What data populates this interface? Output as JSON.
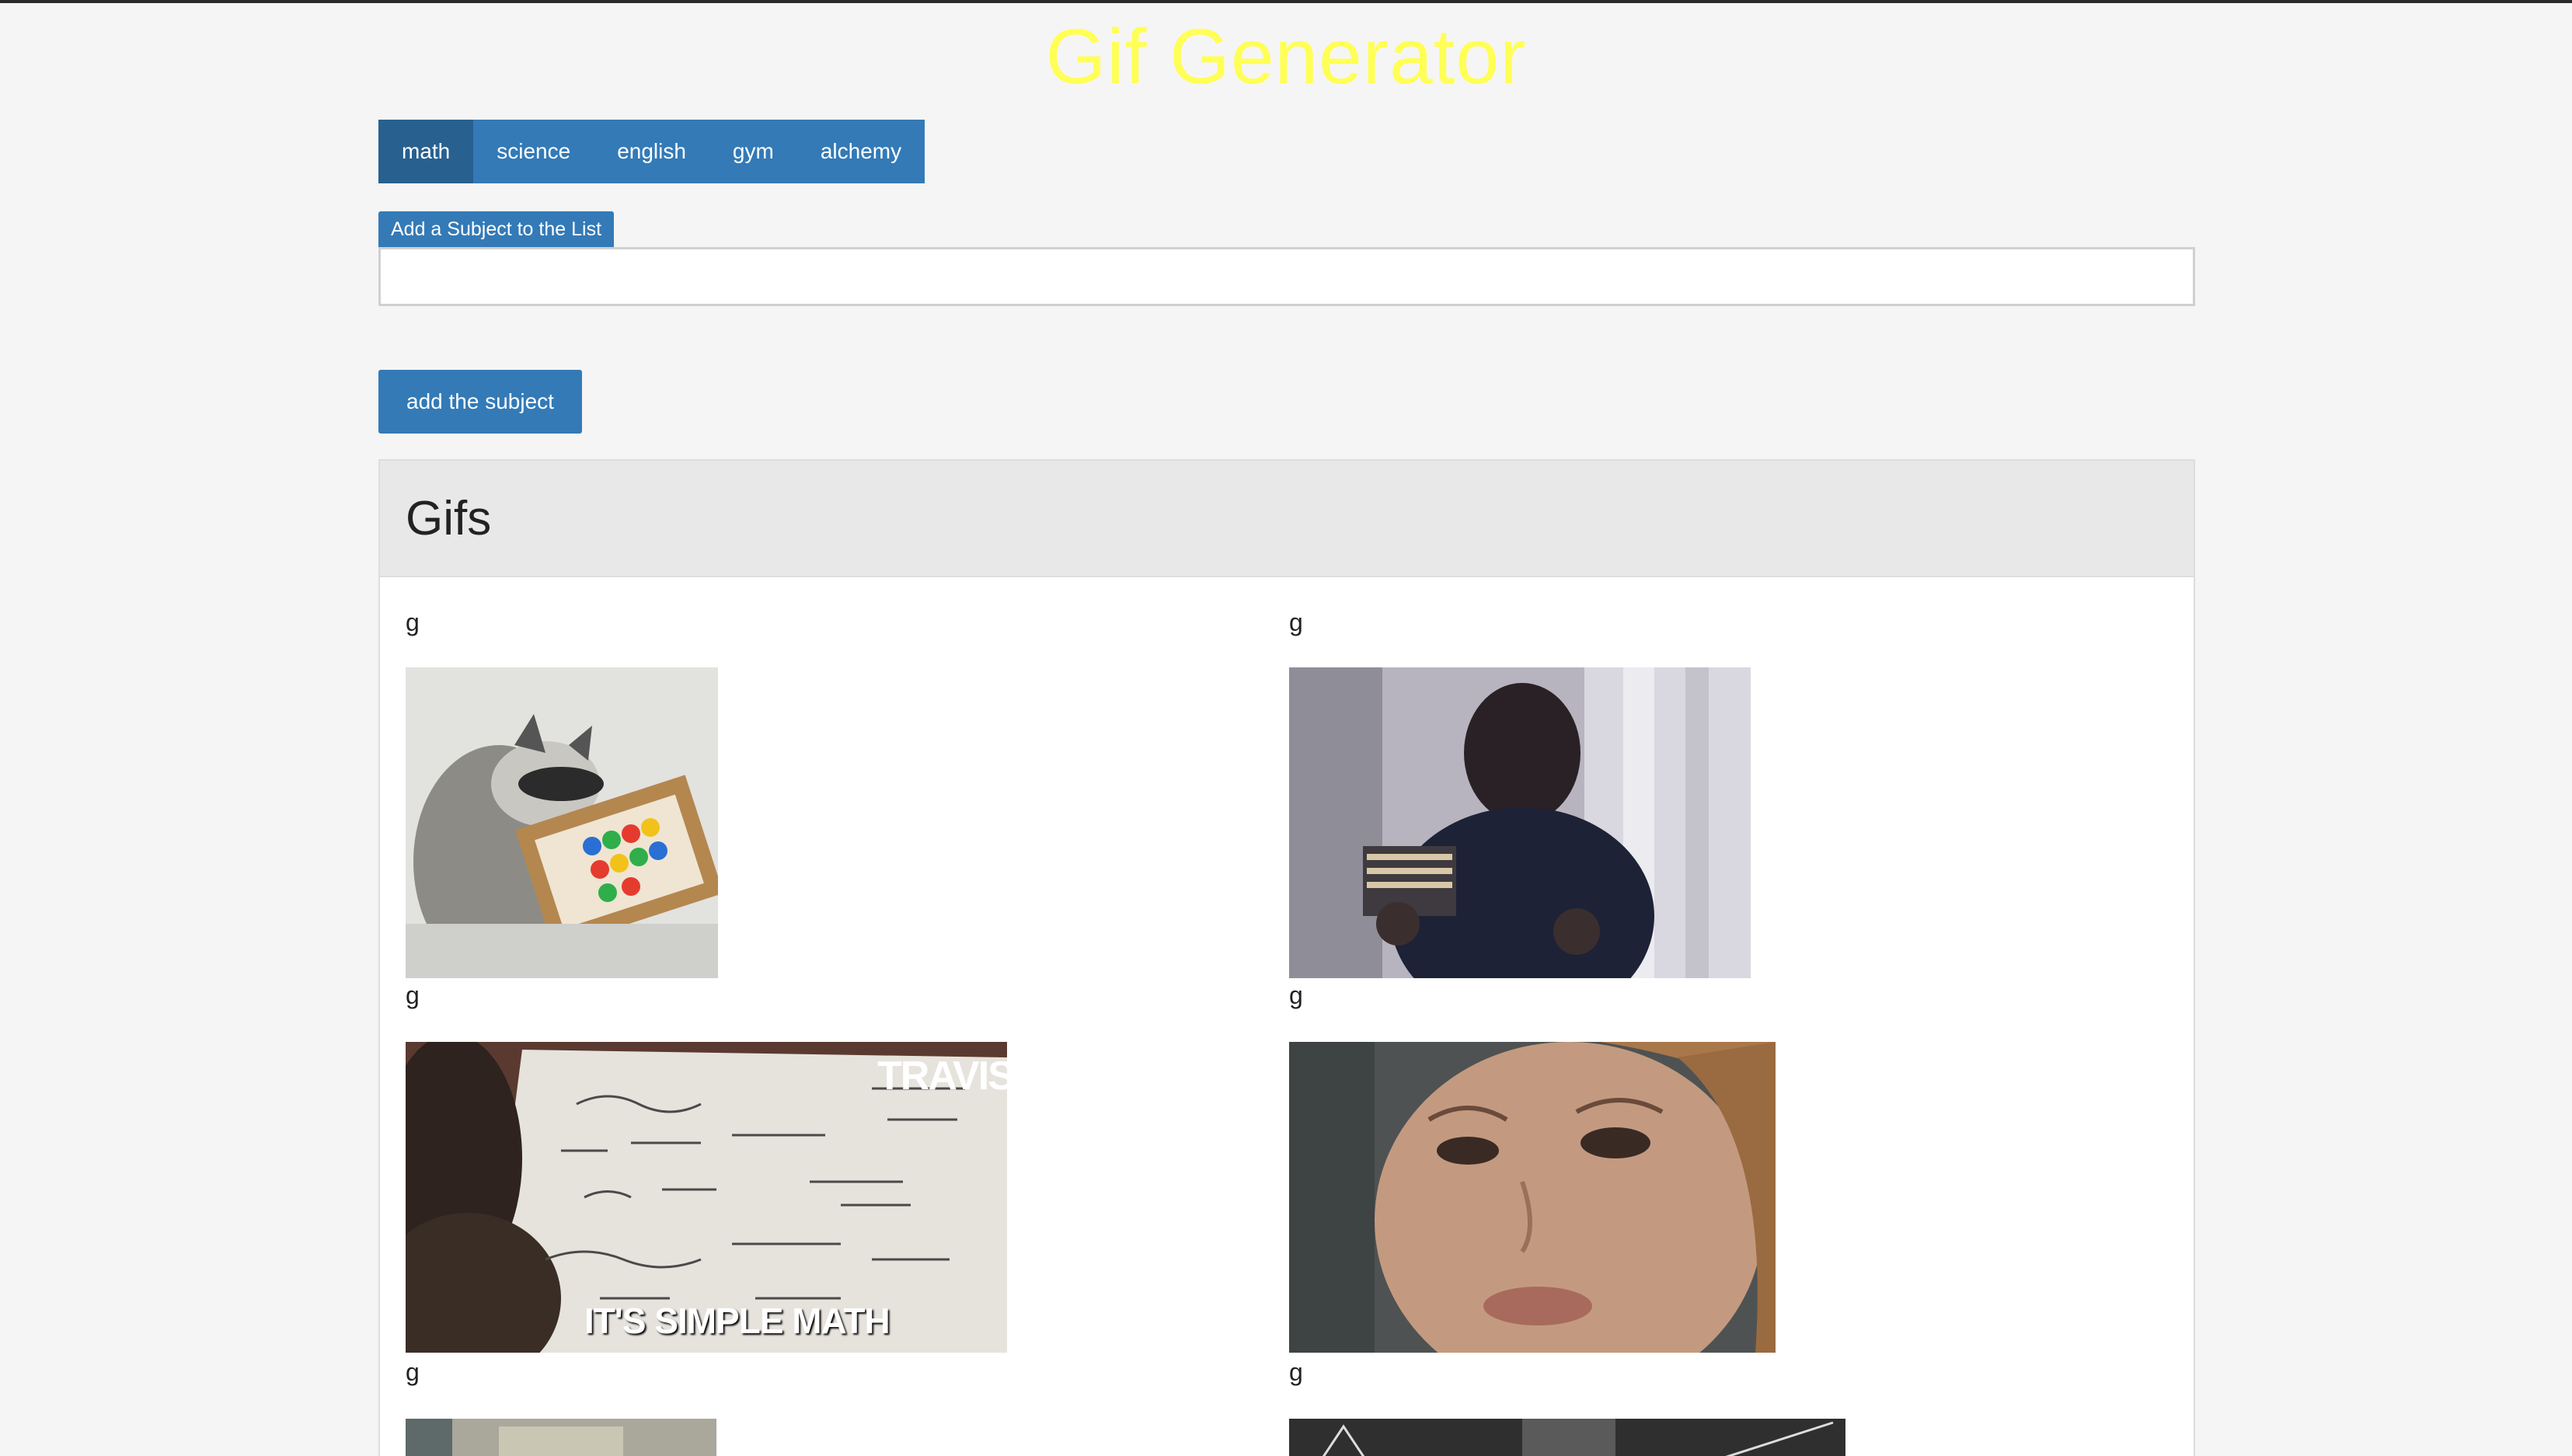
{
  "app": {
    "title": "Gif Generator",
    "title_color": "#ffff55",
    "accent_color": "#337ab7"
  },
  "subjects": [
    {
      "label": "math",
      "active": true
    },
    {
      "label": "science",
      "active": false
    },
    {
      "label": "english",
      "active": false
    },
    {
      "label": "gym",
      "active": false
    },
    {
      "label": "alchemy",
      "active": false
    }
  ],
  "form": {
    "label": "Add a Subject to the List",
    "input_value": "",
    "submit_label": "add the subject"
  },
  "gifs_panel": {
    "heading": "Gifs",
    "items": [
      {
        "rating": "g",
        "image": "raccoon-abacus",
        "overlay_text": ""
      },
      {
        "rating": "g",
        "image": "boy-counting-money",
        "overlay_text": ""
      },
      {
        "rating": "g",
        "image": "math-equations-paper",
        "overlay_text": "IT'S SIMPLE MATH",
        "watermark": "TRAVIS"
      },
      {
        "rating": "g",
        "image": "confused-woman-face",
        "overlay_text": ""
      },
      {
        "rating": "g",
        "image": "partial-gif-5",
        "overlay_text": ""
      },
      {
        "rating": "g",
        "image": "partial-gif-6",
        "overlay_text": ""
      }
    ]
  }
}
